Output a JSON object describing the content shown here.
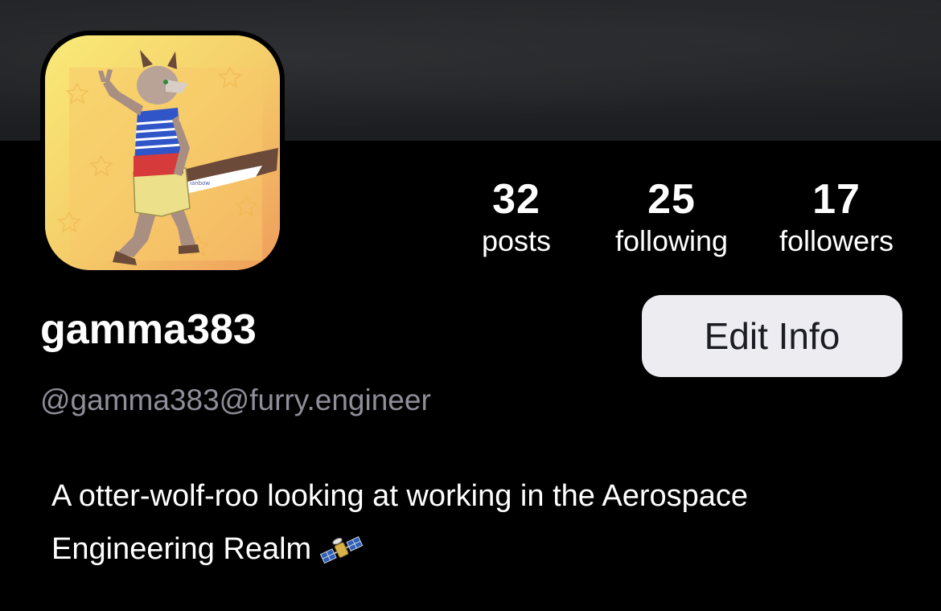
{
  "profile": {
    "display_name": "gamma383",
    "handle": "@gamma383@furry.engineer",
    "bio_line_1": "A otter-wolf-roo looking at working in the Aerospace",
    "bio_line_2": "Engineering Realm",
    "bio_emoji": "satellite-icon"
  },
  "stats": {
    "posts": {
      "count": "32",
      "label": "posts"
    },
    "following": {
      "count": "25",
      "label": "following"
    },
    "followers": {
      "count": "17",
      "label": "followers"
    }
  },
  "actions": {
    "edit_label": "Edit Info"
  },
  "colors": {
    "background": "#000000",
    "banner": "#1f2124",
    "button_bg": "#ececf1",
    "button_text": "#1c1c24",
    "handle_text": "#8f8e99"
  }
}
